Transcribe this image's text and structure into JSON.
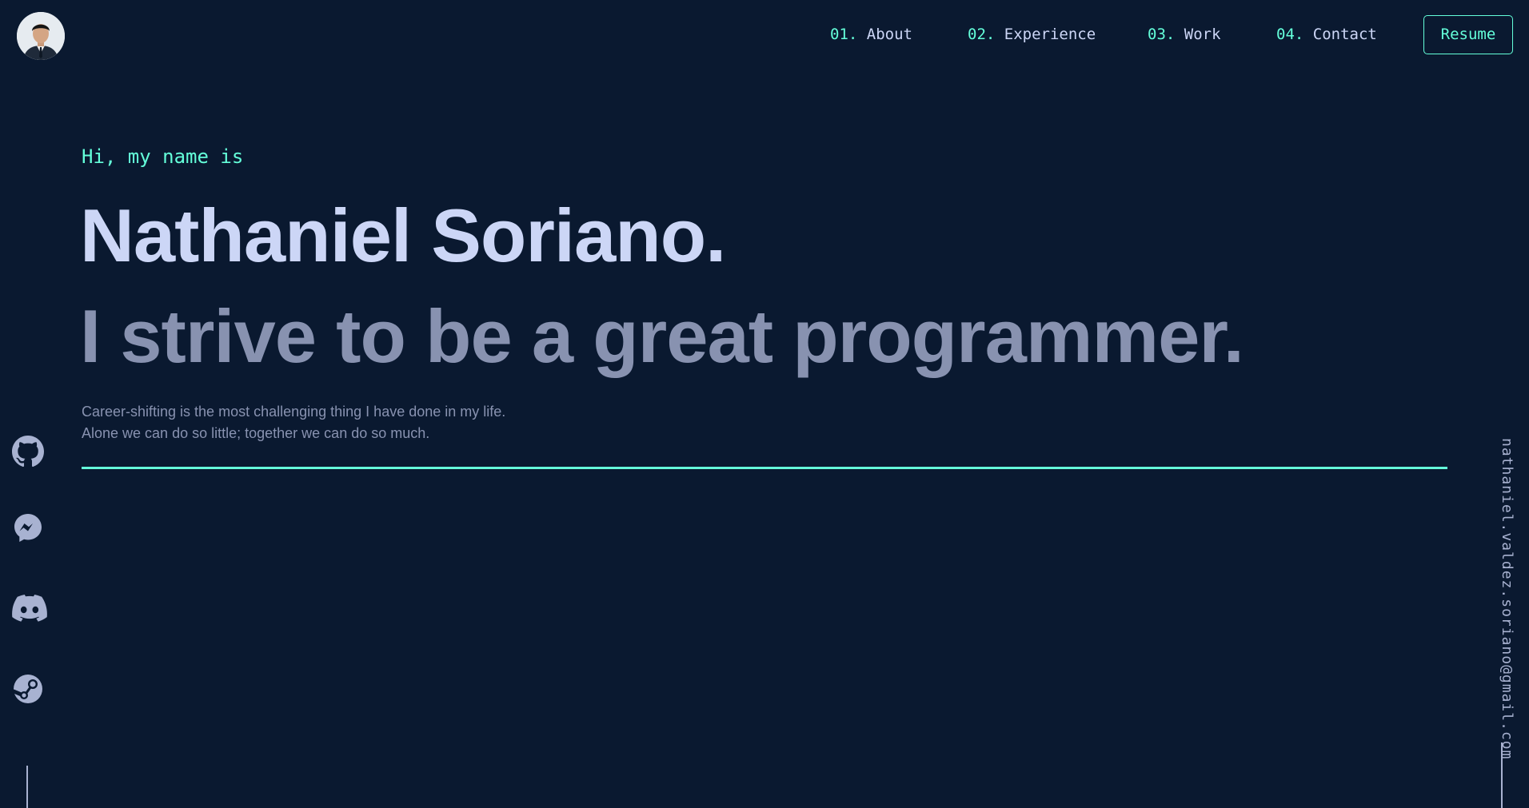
{
  "header": {
    "logo_icon": "avatar-portrait",
    "nav": [
      {
        "num": "01.",
        "label": "About"
      },
      {
        "num": "02.",
        "label": "Experience"
      },
      {
        "num": "03.",
        "label": "Work"
      },
      {
        "num": "04.",
        "label": "Contact"
      }
    ],
    "resume_label": "Resume"
  },
  "hero": {
    "intro": "Hi, my name is",
    "name": "Nathaniel Soriano.",
    "tagline": "I strive to be a great programmer.",
    "description_lines": [
      "Career-shifting is the most challenging thing I have done in my life.",
      "Alone we can do so little; together we can do so much."
    ]
  },
  "social": [
    {
      "icon": "github-icon"
    },
    {
      "icon": "messenger-icon"
    },
    {
      "icon": "discord-icon"
    },
    {
      "icon": "steam-icon"
    }
  ],
  "email": "nathaniel.valdez.soriano@gmail.com",
  "colors": {
    "background": "#0a1930",
    "accent": "#64ffda",
    "heading": "#ccd6f6",
    "text": "#8892b0"
  }
}
